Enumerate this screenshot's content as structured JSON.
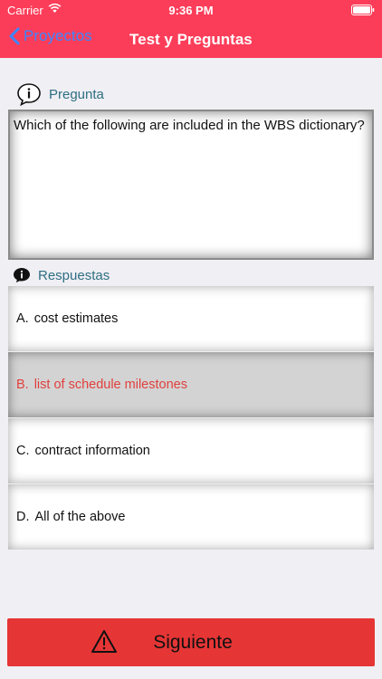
{
  "status_bar": {
    "carrier": "Carrier",
    "time": "9:36 PM"
  },
  "nav": {
    "back_label": "Proyectos",
    "title": "Test y Preguntas"
  },
  "question_section": {
    "label": "Pregunta",
    "text": "Which of the following are included in the WBS dictionary?"
  },
  "answers_section": {
    "label": "Respuestas",
    "items": [
      {
        "letter": "A.",
        "text": "cost estimates",
        "selected": false
      },
      {
        "letter": "B.",
        "text": "list of schedule milestones",
        "selected": true
      },
      {
        "letter": "C.",
        "text": "contract information",
        "selected": false
      },
      {
        "letter": "D.",
        "text": "All of the above",
        "selected": false
      }
    ]
  },
  "footer": {
    "next_label": "Siguiente"
  },
  "colors": {
    "header_bg": "#fc3d59",
    "back_link": "#3d86ff",
    "section_label": "#2f6f82",
    "selected_text": "#e0403d",
    "next_button_bg": "#e63535"
  }
}
